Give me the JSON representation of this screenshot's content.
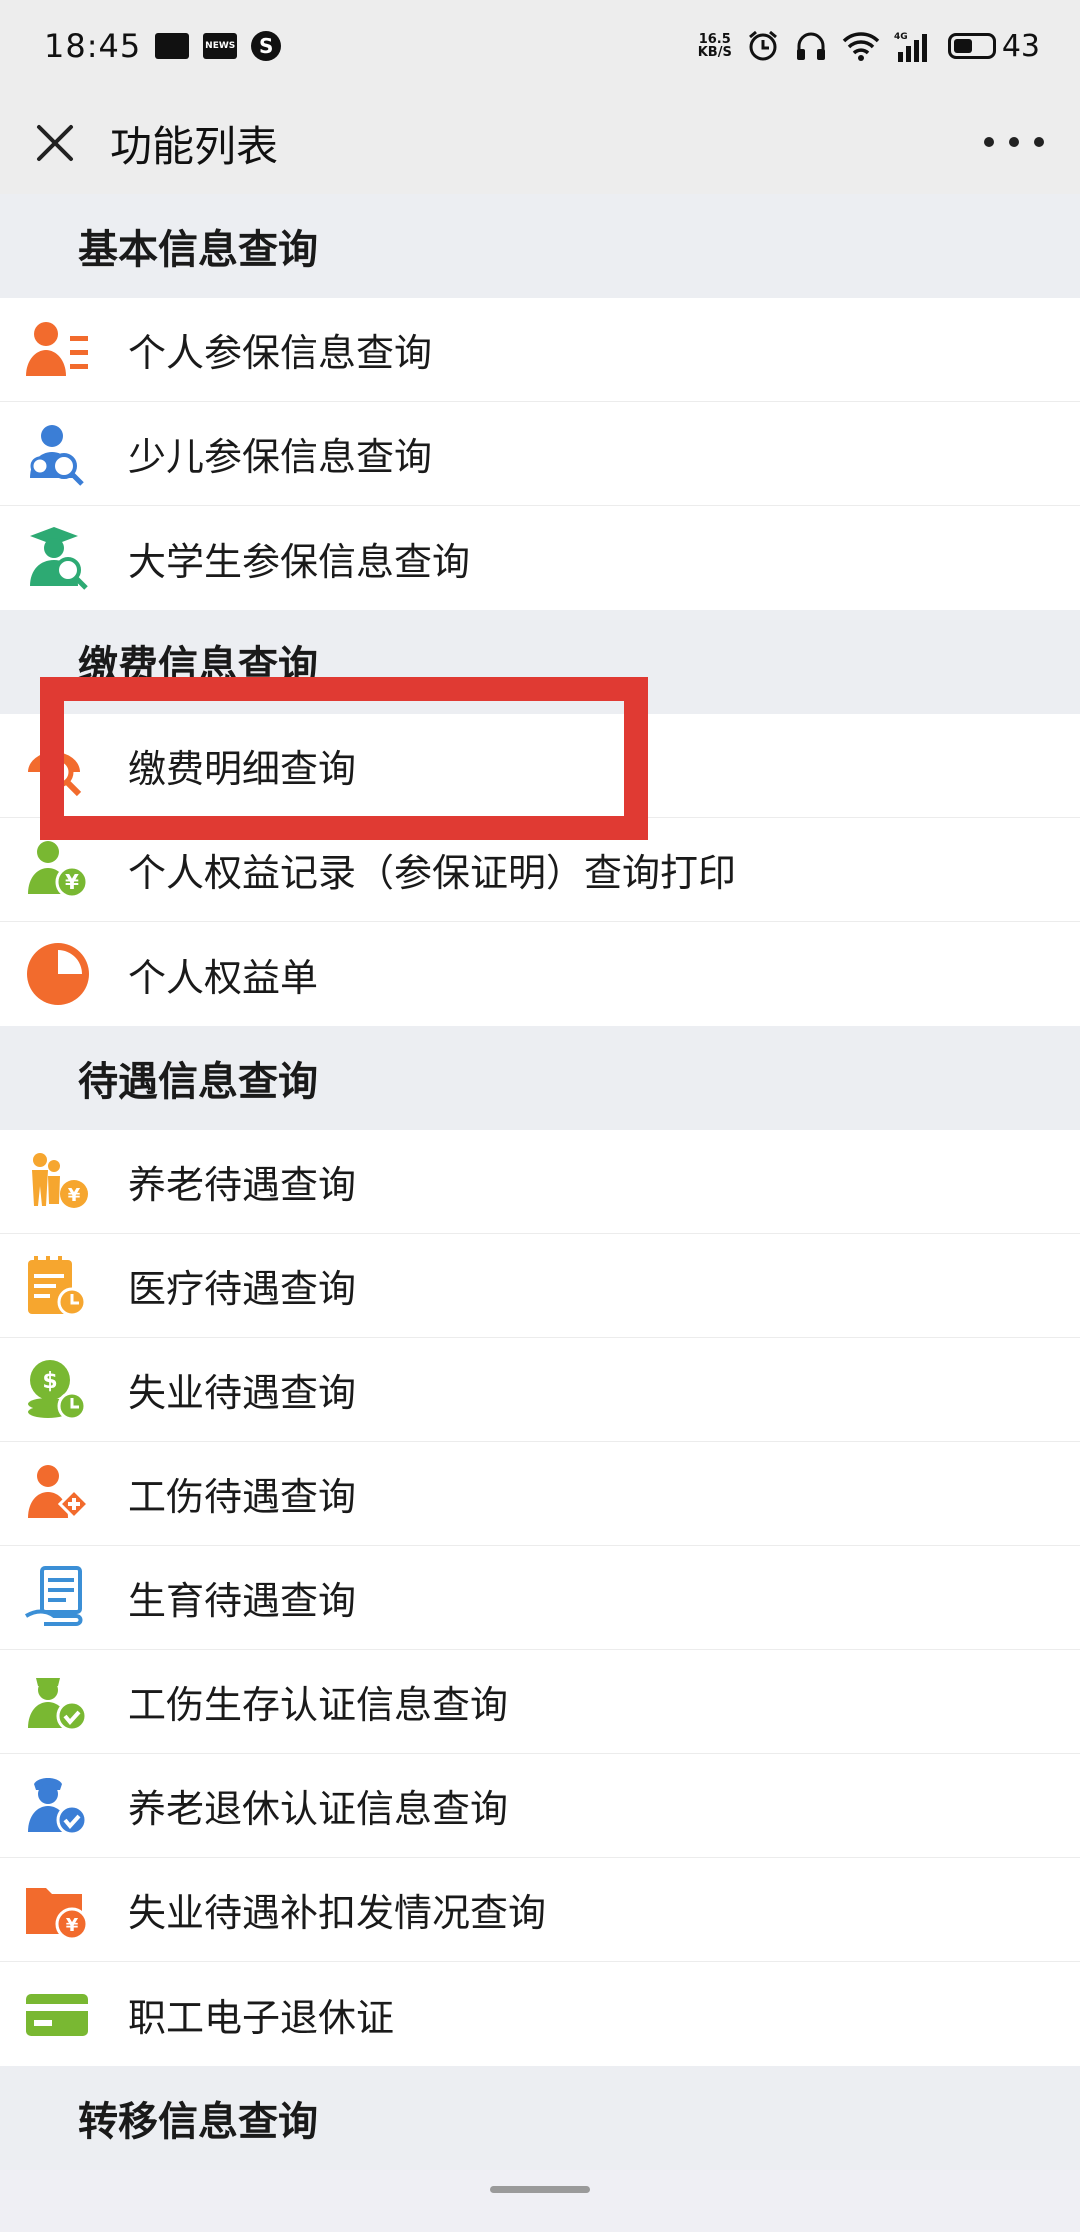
{
  "status_bar": {
    "time": "18:45",
    "news_label": "NEWS",
    "speed_value": "16.5",
    "speed_unit": "KB/S",
    "network": "4G",
    "battery": "43"
  },
  "title_bar": {
    "title": "功能列表"
  },
  "sections": [
    {
      "title": "基本信息查询",
      "items": [
        {
          "label": "个人参保信息查询",
          "icon": "person-list-icon",
          "color": "#f26b2d"
        },
        {
          "label": "少儿参保信息查询",
          "icon": "child-search-icon",
          "color": "#3b7ed6"
        },
        {
          "label": "大学生参保信息查询",
          "icon": "graduate-search-icon",
          "color": "#2daa73"
        }
      ]
    },
    {
      "title": "缴费信息查询",
      "items": [
        {
          "label": "缴费明细查询",
          "icon": "payment-search-icon",
          "color": "#f26b2d"
        },
        {
          "label": "个人权益记录（参保证明）查询打印",
          "icon": "person-yuan-icon",
          "color": "#79b832"
        },
        {
          "label": "个人权益单",
          "icon": "pie-chart-icon",
          "color": "#f26b2d"
        }
      ]
    },
    {
      "title": "待遇信息查询",
      "items": [
        {
          "label": "养老待遇查询",
          "icon": "elderly-yuan-icon",
          "color": "#f6a62f"
        },
        {
          "label": "医疗待遇查询",
          "icon": "calendar-clock-icon",
          "color": "#f6a62f"
        },
        {
          "label": "失业待遇查询",
          "icon": "coins-clock-icon",
          "color": "#79b832"
        },
        {
          "label": "工伤待遇查询",
          "icon": "injury-person-icon",
          "color": "#f26b2d"
        },
        {
          "label": "生育待遇查询",
          "icon": "document-hand-icon",
          "color": "#3b8fd6"
        },
        {
          "label": "工伤生存认证信息查询",
          "icon": "person-check-green-icon",
          "color": "#79b832"
        },
        {
          "label": "养老退休认证信息查询",
          "icon": "person-check-blue-icon",
          "color": "#3b7ed6"
        },
        {
          "label": "失业待遇补扣发情况查询",
          "icon": "folder-yuan-icon",
          "color": "#f26b2d"
        },
        {
          "label": "职工电子退休证",
          "icon": "card-icon",
          "color": "#79b832"
        }
      ]
    },
    {
      "title": "转移信息查询",
      "items": []
    }
  ],
  "highlight": {
    "target": "缴费明细查询",
    "color": "#e03a33"
  }
}
